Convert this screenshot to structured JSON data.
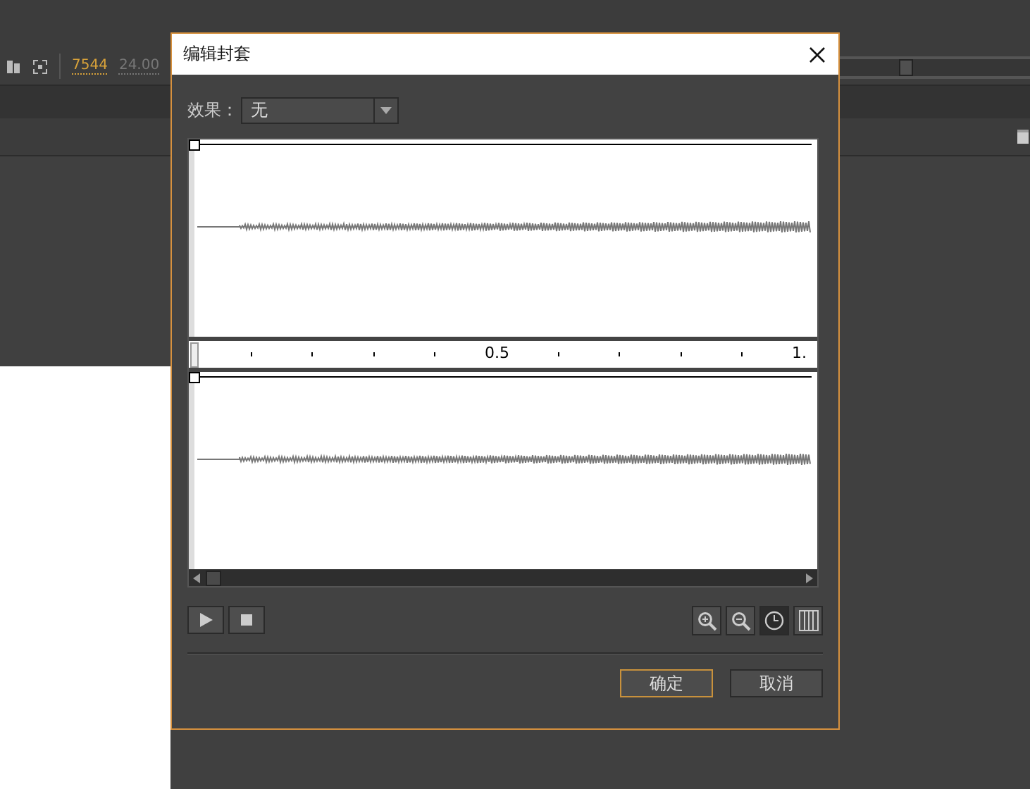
{
  "background_app": {
    "frame_number": "7544",
    "frame_rate": "24.00"
  },
  "dialog": {
    "title": "编辑封套",
    "effect": {
      "label": "效果：",
      "value": "无"
    },
    "ruler": {
      "labels": [
        {
          "text": "0.5"
        },
        {
          "text": "1."
        }
      ]
    },
    "transport": [
      {
        "kind": "play"
      },
      {
        "kind": "stop"
      }
    ],
    "view_tools": [
      {
        "kind": "zoom-in",
        "selected": false
      },
      {
        "kind": "zoom-out",
        "selected": false
      },
      {
        "kind": "seconds",
        "selected": true
      },
      {
        "kind": "frames",
        "selected": false
      }
    ],
    "buttons": [
      {
        "label": "确定",
        "focused": true
      },
      {
        "label": "取消",
        "focused": false
      }
    ]
  }
}
